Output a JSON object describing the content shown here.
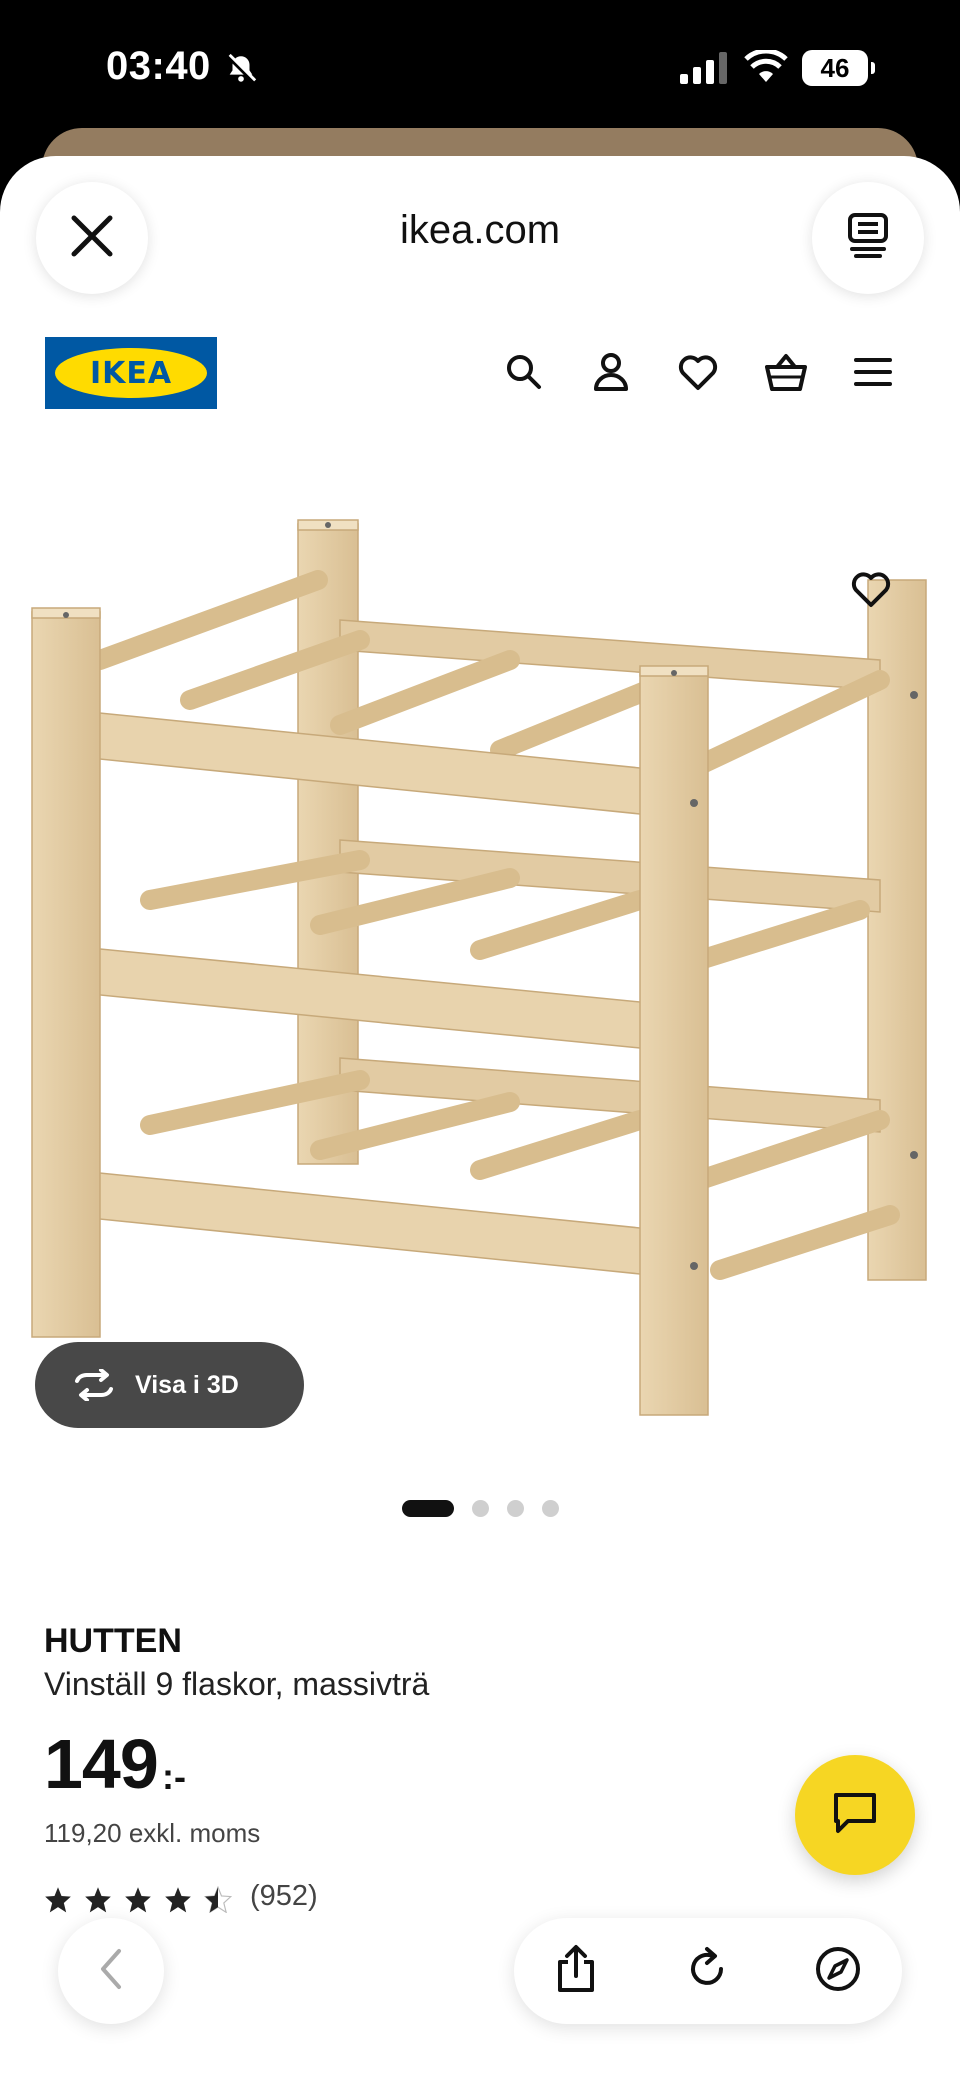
{
  "status_bar": {
    "time": "03:40",
    "battery": "46",
    "icons": [
      "bell-slash-icon",
      "signal-icon",
      "wifi-icon",
      "battery-icon"
    ]
  },
  "browser": {
    "domain": "ikea.com",
    "buttons": [
      "close-icon",
      "tab-overview-icon",
      "back-chevron-icon",
      "share-icon",
      "reload-icon",
      "compass-icon"
    ]
  },
  "site_header": {
    "logo_text": "IKEA",
    "nav_icons": [
      "search-icon",
      "account-icon",
      "heart-icon",
      "cart-icon",
      "menu-icon"
    ]
  },
  "gallery": {
    "view3d_label": "Visa i 3D",
    "total_images": 4,
    "active_index": 0
  },
  "product": {
    "brand": "HUTTEN",
    "description": "Vinställ 9 flaskor, massivträ",
    "price": "149",
    "price_suffix": ":-",
    "price_ex_vat": "119,20 exkl. moms",
    "rating": 4.5,
    "review_count": "(952)"
  },
  "colors": {
    "ikea_blue": "#0058a3",
    "ikea_yellow": "#ffdb00",
    "chat_yellow": "#f6d623",
    "wood": "#e6cfa8"
  }
}
